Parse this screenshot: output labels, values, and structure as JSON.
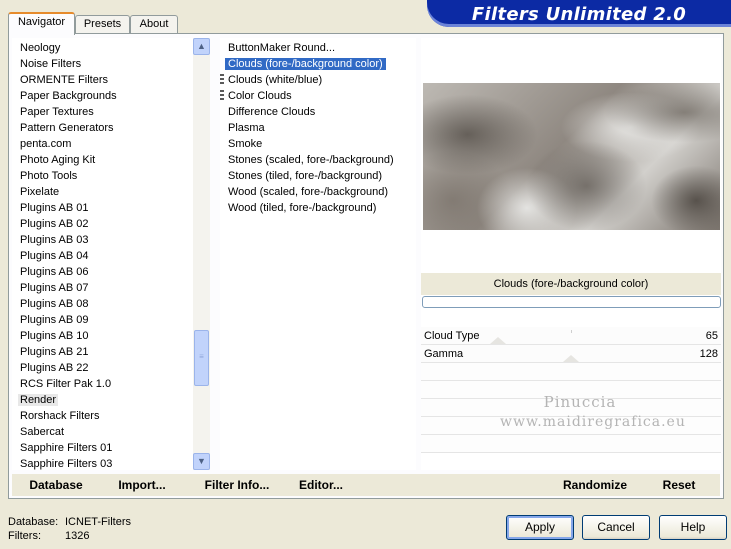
{
  "tabs": [
    "Navigator",
    "Presets",
    "About"
  ],
  "banner_title": "Filters Unlimited 2.0",
  "categories": [
    "Neology",
    "Noise Filters",
    "ORMENTE Filters",
    "Paper Backgrounds",
    "Paper Textures",
    "Pattern Generators",
    "penta.com",
    "Photo Aging Kit",
    "Photo Tools",
    "Pixelate",
    "Plugins AB 01",
    "Plugins AB 02",
    "Plugins AB 03",
    "Plugins AB 04",
    "Plugins AB 06",
    "Plugins AB 07",
    "Plugins AB 08",
    "Plugins AB 09",
    "Plugins AB 10",
    "Plugins AB 21",
    "Plugins AB 22",
    "RCS Filter Pak 1.0",
    "Render",
    "Rorshack Filters",
    "Sabercat",
    "Sapphire Filters 01",
    "Sapphire Filters 03"
  ],
  "selected_category": "Render",
  "filters": [
    "ButtonMaker Round...",
    "Clouds (fore-/background color)",
    "Clouds (white/blue)",
    "Color Clouds",
    "Difference Clouds",
    "Plasma",
    "Smoke",
    "Stones (scaled, fore-/background)",
    "Stones (tiled, fore-/background)",
    "Wood (scaled, fore-/background)",
    "Wood (tiled, fore-/background)"
  ],
  "selected_filter": "Clouds (fore-/background color)",
  "current_filter_name": "Clouds (fore-/background color)",
  "params": [
    {
      "name": "Cloud Type",
      "value": "65"
    },
    {
      "name": "Gamma",
      "value": "128"
    }
  ],
  "watermark": [
    "Pinuccia",
    "www.maidiregrafica.eu"
  ],
  "bottom_buttons": {
    "database": "Database",
    "import": "Import...",
    "filter_info": "Filter Info...",
    "editor": "Editor...",
    "randomize": "Randomize",
    "reset": "Reset"
  },
  "status": {
    "database_label": "Database:",
    "database_value": "ICNET-Filters",
    "filters_label": "Filters:",
    "filters_value": "1326"
  },
  "dialog_buttons": {
    "apply": "Apply",
    "cancel": "Cancel",
    "help": "Help"
  },
  "colors": {
    "accent": "#316ac5",
    "banner": "#0c2aa4",
    "tab_highlight": "#e68b2c"
  }
}
